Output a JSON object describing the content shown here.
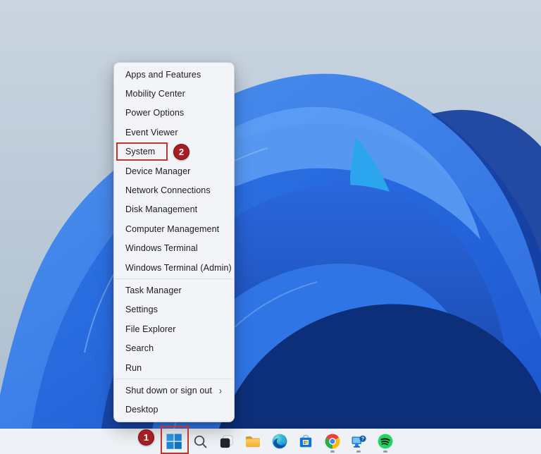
{
  "menu": {
    "items": [
      {
        "label": "Apps and Features"
      },
      {
        "label": "Mobility Center"
      },
      {
        "label": "Power Options"
      },
      {
        "label": "Event Viewer"
      },
      {
        "label": "System"
      },
      {
        "label": "Device Manager"
      },
      {
        "label": "Network Connections"
      },
      {
        "label": "Disk Management"
      },
      {
        "label": "Computer Management"
      },
      {
        "label": "Windows Terminal"
      },
      {
        "label": "Windows Terminal (Admin)"
      },
      {
        "label": "Task Manager"
      },
      {
        "label": "Settings"
      },
      {
        "label": "File Explorer"
      },
      {
        "label": "Search"
      },
      {
        "label": "Run"
      },
      {
        "label": "Shut down or sign out",
        "has_submenu": true
      },
      {
        "label": "Desktop"
      }
    ]
  },
  "icons": {
    "chevron_right": "›"
  },
  "taskbar": {
    "buttons": [
      {
        "name": "start",
        "running": false
      },
      {
        "name": "search",
        "running": false
      },
      {
        "name": "task-view",
        "running": false
      },
      {
        "name": "file-explorer",
        "running": false
      },
      {
        "name": "edge",
        "running": false
      },
      {
        "name": "microsoft-store",
        "running": false
      },
      {
        "name": "chrome",
        "running": true
      },
      {
        "name": "get-help",
        "running": true
      },
      {
        "name": "spotify",
        "running": true
      }
    ]
  },
  "annotations": {
    "step1": {
      "label": "1"
    },
    "step2": {
      "label": "2"
    }
  },
  "colors": {
    "annotation_red": "#c2342f",
    "badge_red": "#a51e23",
    "menu_bg": "#f2f4f7",
    "taskbar_bg": "#eef1f5",
    "start_blue": "#1e87da",
    "folder_yellow": "#ffc845",
    "edge_blue": "#0b54b4",
    "store_blue": "#1173d2",
    "spotify_green": "#1ed760",
    "chrome_red": "#ea4335",
    "chrome_green": "#34a853",
    "chrome_yellow": "#fbbc05",
    "chrome_blue": "#4285f4"
  }
}
